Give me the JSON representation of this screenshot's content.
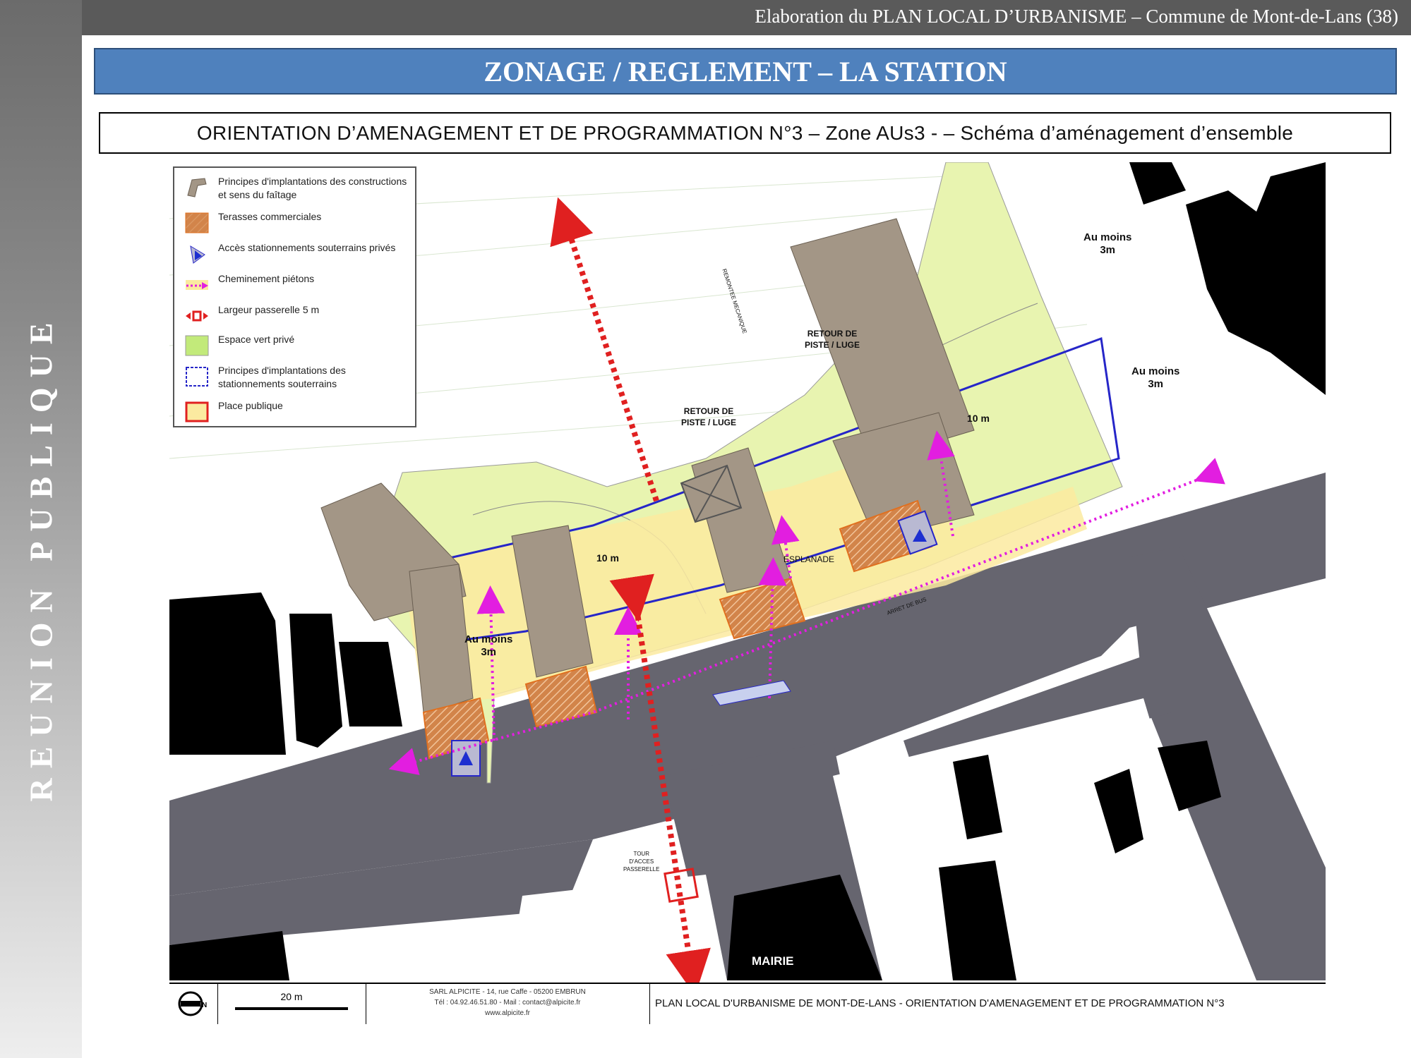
{
  "sidebar": {
    "text": "REUNION PUBLIQUE"
  },
  "header": {
    "text": "Elaboration du PLAN LOCAL D’URBANISME – Commune  de Mont-de-Lans (38)"
  },
  "title": "ZONAGE / REGLEMENT – LA STATION",
  "subtitle": "ORIENTATION D’AMENAGEMENT ET DE PROGRAMMATION N°3 – Zone AUs3 - – Schéma d’aménagement d’ensemble",
  "legend": [
    {
      "label": "Principes d'implantations des constructions et sens du faîtage",
      "icon": "building-footprint-icon"
    },
    {
      "label": "Terasses commerciales",
      "icon": "hatched-orange-swatch"
    },
    {
      "label": "Accès stationnements souterrains privés",
      "icon": "blue-triangle-icon"
    },
    {
      "label": "Cheminement piétons",
      "icon": "pink-dotted-arrow-icon"
    },
    {
      "label": "Largeur passerelle 5 m",
      "icon": "red-dashed-arrow-icon"
    },
    {
      "label": "Espace vert privé",
      "icon": "green-swatch"
    },
    {
      "label": "Principes d'implantations des stationnements souterrains",
      "icon": "blue-dashed-box-icon"
    },
    {
      "label": "Place publique",
      "icon": "yellow-red-box-icon"
    }
  ],
  "map_labels": {
    "au_moins_top": "Au moins\n3m",
    "au_moins_right": "Au moins\n3m",
    "au_moins_left": "Au moins\n3m",
    "retour_1": "RETOUR DE\nPISTE / LUGE",
    "retour_2": "RETOUR DE\nPISTE / LUGE",
    "ten_m_right": "10 m",
    "ten_m_left": "10 m",
    "esplanade": "ESPLANADE",
    "mairie": "MAIRIE",
    "tour": "TOUR\nD'ACCES\nPASSERELLE",
    "arret_bus": "ARRET DE BUS",
    "remontee": "REMONTEE MECANIQUE"
  },
  "footer": {
    "scale": "20 m",
    "company": "SARL ALPICITE - 14, rue Caffe - 05200 EMBRUN\nTél : 04.92.46.51.80 - Mail : contact@alpicite.fr\nwww.alpicite.fr",
    "plan_title": "PLAN LOCAL D'URBANISME DE MONT-DE-LANS - ORIENTATION D'AMENAGEMENT ET DE PROGRAMMATION N°3"
  },
  "colors": {
    "header_bg": "#5a5a5a",
    "title_bg": "#4f81bd",
    "road": "#66656f",
    "green_space": "#e8f4b0",
    "building": "#a39686",
    "terrace": "#d2844a",
    "parking_outline": "#2626c8",
    "place_publique": "#fbeaa0",
    "pedestrian": "#e21ee0",
    "passerelle": "#e02020"
  }
}
